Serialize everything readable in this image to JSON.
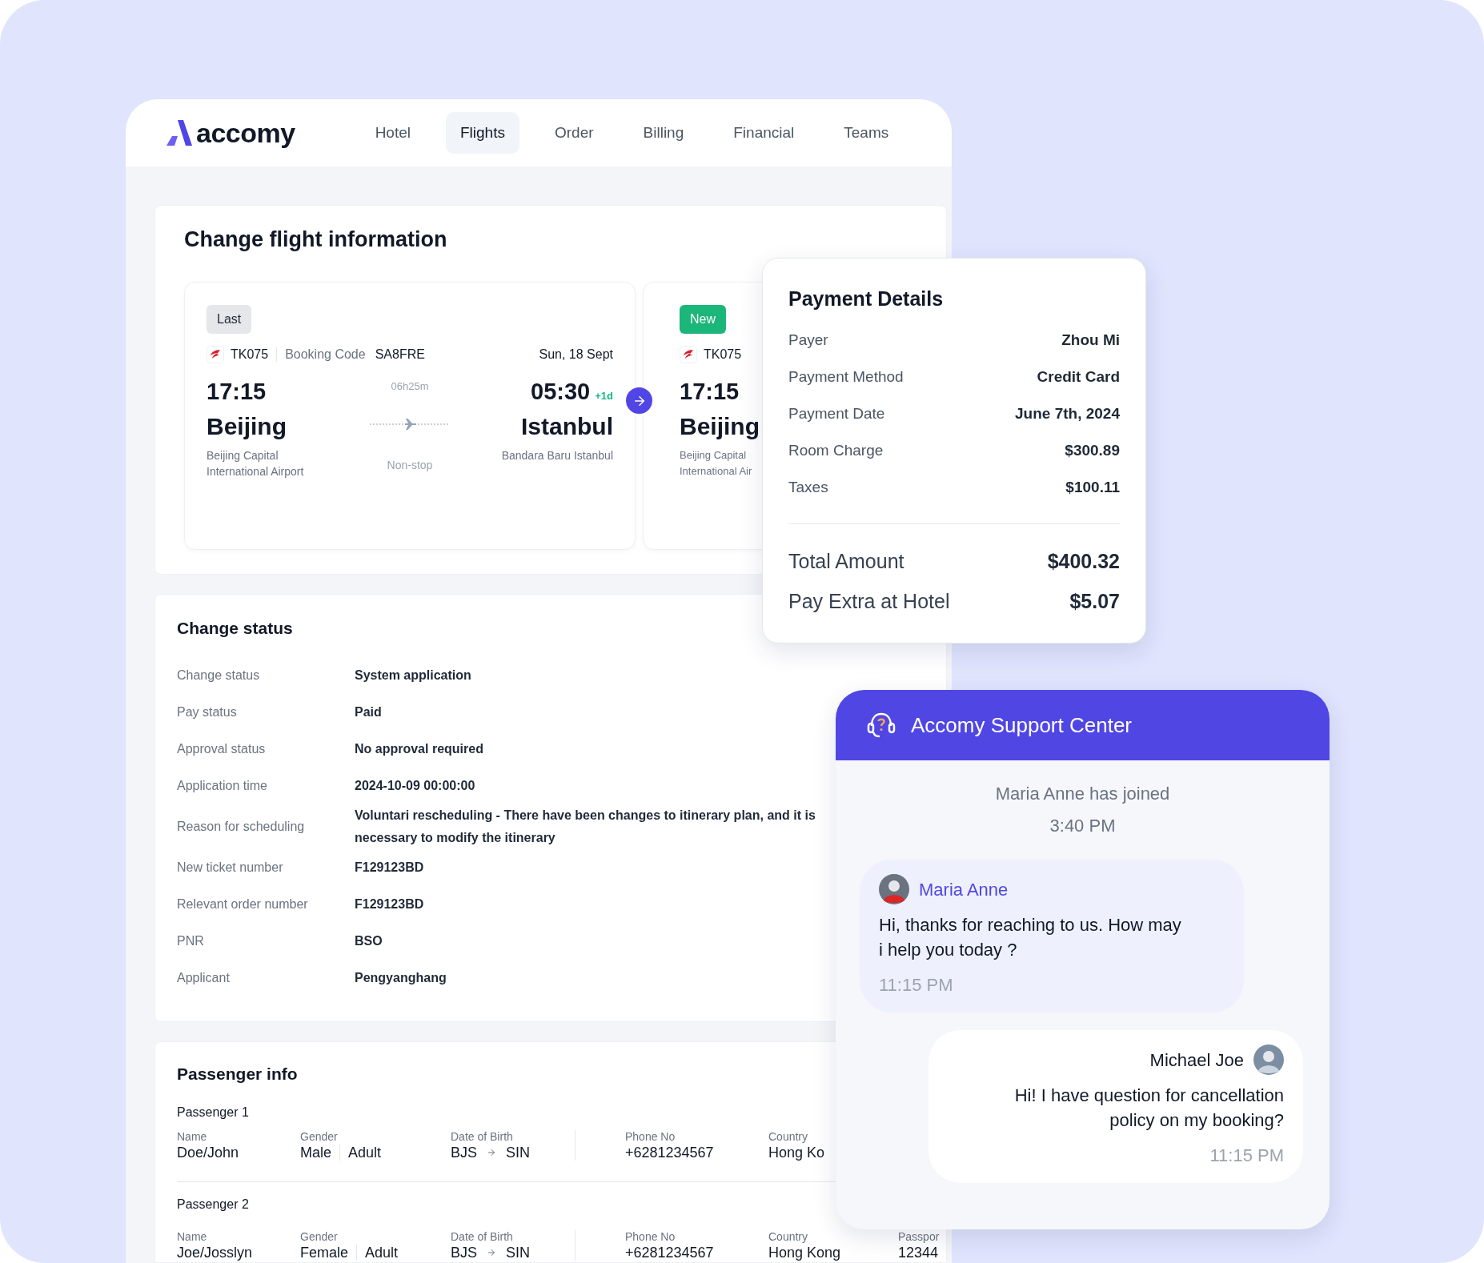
{
  "brand": {
    "name": "accomy"
  },
  "nav": [
    {
      "label": "Hotel",
      "selected": false
    },
    {
      "label": "Flights",
      "selected": true
    },
    {
      "label": "Order",
      "selected": false
    },
    {
      "label": "Billing",
      "selected": false
    },
    {
      "label": "Financial",
      "selected": false
    },
    {
      "label": "Teams",
      "selected": false
    }
  ],
  "page_title": "Change flight information",
  "flights": [
    {
      "kind": "last",
      "badge": "Last",
      "flight_no": "TK075",
      "booking_code_label": "Booking Code",
      "booking_code": "SA8FRE",
      "date": "Sun, 18 Sept",
      "depart_time": "17:15",
      "depart_city": "Beijing",
      "depart_airport": "Beijing Capital International Airport",
      "duration": "06h25m",
      "stops": "Non-stop",
      "arrive_time": "05:30",
      "day_offset": "+1d",
      "arrive_city": "Istanbul",
      "arrive_airport": "Bandara Baru Istanbul"
    },
    {
      "kind": "new",
      "badge": "New",
      "flight_no": "TK075",
      "depart_time": "17:15",
      "depart_city": "Beijing",
      "depart_airport": "Beijing Capital International Air"
    }
  ],
  "payment": {
    "title": "Payment Details",
    "rows": [
      {
        "label": "Payer",
        "value": "Zhou Mi"
      },
      {
        "label": "Payment Method",
        "value": "Credit Card"
      },
      {
        "label": "Payment Date",
        "value": "June 7th, 2024"
      },
      {
        "label": "Room Charge",
        "value": "$300.89"
      },
      {
        "label": "Taxes",
        "value": "$100.11"
      }
    ],
    "totals": [
      {
        "label": "Total Amount",
        "value": "$400.32"
      },
      {
        "label": "Pay Extra at Hotel",
        "value": "$5.07"
      }
    ]
  },
  "change_status": {
    "title": "Change status",
    "rows": [
      {
        "label": "Change status",
        "value": "System application"
      },
      {
        "label": "Pay status",
        "value": "Paid"
      },
      {
        "label": "Approval status",
        "value": "No approval required"
      },
      {
        "label": "Application time",
        "value": "2024-10-09 00:00:00"
      },
      {
        "label": "Reason for scheduling",
        "value": "Voluntari rescheduling - There have been changes to itinerary plan, and it is necessary to modify the itinerary"
      },
      {
        "label": "New ticket number",
        "value": "F129123BD"
      },
      {
        "label": "Relevant order number",
        "value": "F129123BD"
      },
      {
        "label": "PNR",
        "value": "BSO"
      },
      {
        "label": "Applicant",
        "value": "Pengyanghang"
      }
    ]
  },
  "passenger_info": {
    "title": "Passenger info",
    "passengers": [
      {
        "title": "Passenger 1",
        "fields": [
          {
            "kind": "text",
            "label": "Name",
            "value": "Doe/John"
          },
          {
            "kind": "pair",
            "label": "Gender",
            "value": "Male",
            "extra": "Adult"
          },
          {
            "kind": "route",
            "label": "Date of Birth",
            "from": "BJS",
            "to": "SIN"
          },
          {
            "kind": "text",
            "label": "Phone No",
            "value": "+6281234567"
          },
          {
            "kind": "text",
            "label": "Country",
            "value": "Hong Ko"
          }
        ]
      },
      {
        "title": "Passenger 2",
        "fields": [
          {
            "kind": "text",
            "label": "Name",
            "value": "Joe/Josslyn"
          },
          {
            "kind": "pair",
            "label": "Gender",
            "value": "Female",
            "extra": "Adult"
          },
          {
            "kind": "route",
            "label": "Date of Birth",
            "from": "BJS",
            "to": "SIN"
          },
          {
            "kind": "text",
            "label": "Phone No",
            "value": "+6281234567"
          },
          {
            "kind": "text",
            "label": "Country",
            "value": "Hong Kong"
          },
          {
            "kind": "text",
            "label": "Passpor",
            "value": "12344"
          }
        ]
      }
    ]
  },
  "support": {
    "title": "Accomy Support Center",
    "system": {
      "text": "Maria Anne has joined",
      "time": "3:40 PM"
    },
    "messages": [
      {
        "kind": "agent",
        "name": "Maria Anne",
        "text": "Hi, thanks for reaching to us. How may i help you today ?",
        "time": "11:15 PM"
      },
      {
        "kind": "user",
        "name": "Michael Joe",
        "text": "Hi! I have question for cancellation policy on my booking?",
        "time": "11:15 PM"
      }
    ]
  }
}
